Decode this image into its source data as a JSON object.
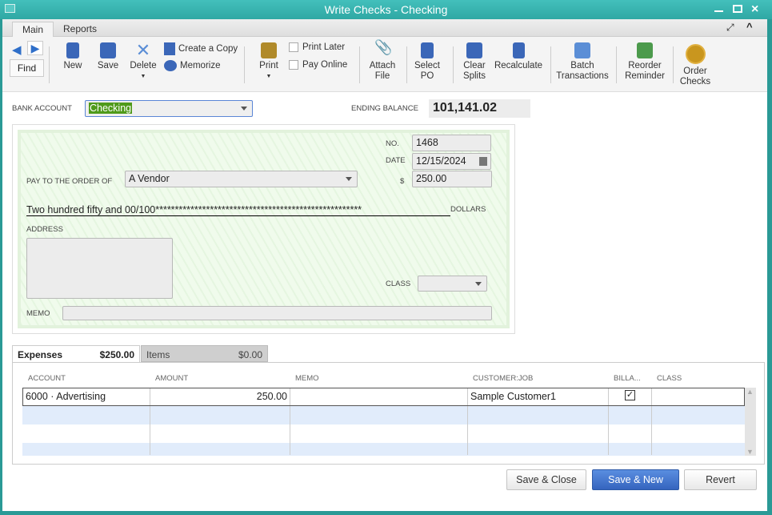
{
  "window": {
    "title": "Write Checks - Checking",
    "menu_icon": "window-menu-icon",
    "controls": [
      "minimize-icon",
      "maximize-icon",
      "close-icon"
    ]
  },
  "ribbon_tabs": [
    {
      "label": "Main",
      "active": true
    },
    {
      "label": "Reports",
      "active": false
    }
  ],
  "toolbar": {
    "find": "Find",
    "new": "New",
    "save": "Save",
    "delete": "Delete",
    "create_copy": "Create a Copy",
    "memorize": "Memorize",
    "print": "Print",
    "print_later": "Print Later",
    "pay_online": "Pay Online",
    "attach_file": [
      "Attach",
      "File"
    ],
    "select_po": [
      "Select",
      "PO"
    ],
    "clear_splits": [
      "Clear",
      "Splits"
    ],
    "recalculate": "Recalculate",
    "batch": [
      "Batch",
      "Transactions"
    ],
    "reorder": [
      "Reorder",
      "Reminder"
    ],
    "order_checks": [
      "Order",
      "Checks"
    ]
  },
  "header": {
    "bank_account_label": "BANK ACCOUNT",
    "bank_account": "Checking",
    "ending_balance_label": "ENDING BALANCE",
    "ending_balance": "101,141.02"
  },
  "check": {
    "no_label": "NO.",
    "no": "1468",
    "date_label": "DATE",
    "date": "12/15/2024",
    "payee_label": "PAY TO THE ORDER OF",
    "payee": "A Vendor",
    "amount_label": "$",
    "amount": "250.00",
    "written_amount": "Two hundred fifty and 00/100*****************************************************",
    "dollars_label": "DOLLARS",
    "address_label": "ADDRESS",
    "address": "",
    "class_label": "CLASS",
    "class": "",
    "memo_label": "MEMO",
    "memo": ""
  },
  "split_tabs": [
    {
      "label": "Expenses",
      "amount": "$250.00",
      "active": true
    },
    {
      "label": "Items",
      "amount": "$0.00",
      "active": false
    }
  ],
  "grid": {
    "columns": [
      "ACCOUNT",
      "AMOUNT",
      "MEMO",
      "CUSTOMER:JOB",
      "BILLA...",
      "CLASS"
    ],
    "rows": [
      {
        "account": "6000 · Advertising",
        "amount": "250.00",
        "memo": "",
        "customer": "Sample Customer1",
        "billable": true,
        "class": ""
      }
    ]
  },
  "buttons": {
    "save_close": "Save & Close",
    "save_new": "Save & New",
    "revert": "Revert"
  },
  "colors": {
    "titlebar": "#3bb8b4",
    "primary_button": "#3d6fc4",
    "selection": "#4f9a1a",
    "check_bg": "#f0fbec"
  }
}
